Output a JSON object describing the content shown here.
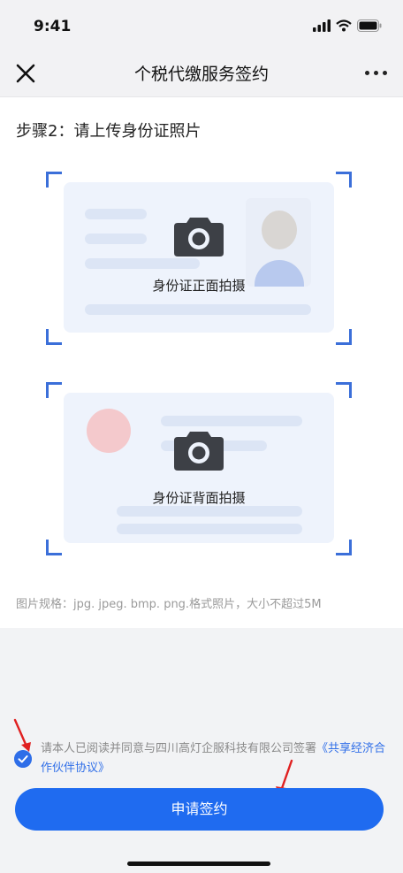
{
  "status": {
    "time": "9:41"
  },
  "nav": {
    "title": "个税代缴服务签约"
  },
  "step": {
    "title": "步骤2：请上传身份证照片"
  },
  "cards": {
    "front_label": "身份证正面拍摄",
    "back_label": "身份证背面拍摄"
  },
  "spec": {
    "text": "图片规格：jpg. jpeg. bmp. png.格式照片，大小不超过5M"
  },
  "agreement": {
    "text": "请本人已阅读并同意与四川高灯企服科技有限公司签署",
    "link": "《共享经济合作伙伴协议》",
    "checked": true
  },
  "apply": {
    "label": "申请签约"
  },
  "colors": {
    "accent": "#1f6bf0",
    "corner": "#3b6fd9",
    "annotation": "#e02020"
  }
}
